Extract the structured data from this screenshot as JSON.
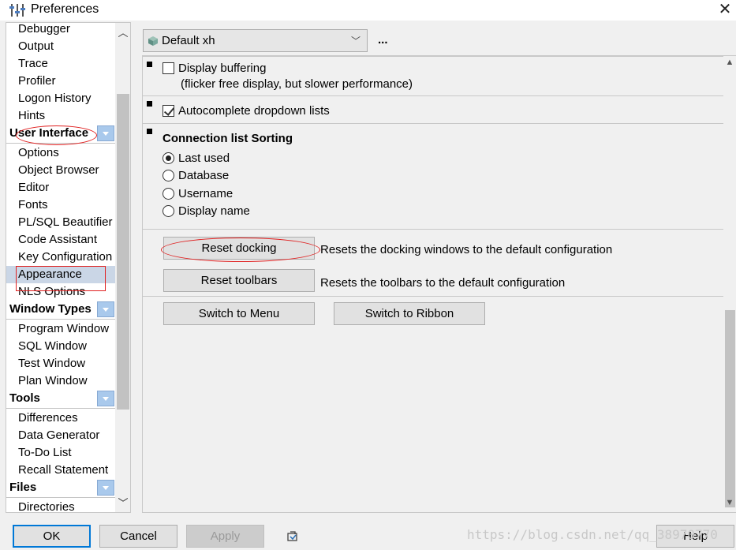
{
  "window": {
    "title": "Preferences"
  },
  "sidebar": {
    "items": [
      {
        "label": "Debugger",
        "type": "item"
      },
      {
        "label": "Output",
        "type": "item"
      },
      {
        "label": "Trace",
        "type": "item"
      },
      {
        "label": "Profiler",
        "type": "item"
      },
      {
        "label": "Logon History",
        "type": "item"
      },
      {
        "label": "Hints",
        "type": "item"
      },
      {
        "label": "User Interface",
        "type": "header"
      },
      {
        "label": "Options",
        "type": "item"
      },
      {
        "label": "Object Browser",
        "type": "item"
      },
      {
        "label": "Editor",
        "type": "item"
      },
      {
        "label": "Fonts",
        "type": "item"
      },
      {
        "label": "PL/SQL Beautifier",
        "type": "item"
      },
      {
        "label": "Code Assistant",
        "type": "item"
      },
      {
        "label": "Key Configuration",
        "type": "item"
      },
      {
        "label": "Appearance",
        "type": "item",
        "selected": true
      },
      {
        "label": "NLS Options",
        "type": "item"
      },
      {
        "label": "Window Types",
        "type": "header"
      },
      {
        "label": "Program Window",
        "type": "item"
      },
      {
        "label": "SQL Window",
        "type": "item"
      },
      {
        "label": "Test Window",
        "type": "item"
      },
      {
        "label": "Plan Window",
        "type": "item"
      },
      {
        "label": "Tools",
        "type": "header"
      },
      {
        "label": "Differences",
        "type": "item"
      },
      {
        "label": "Data Generator",
        "type": "item"
      },
      {
        "label": "To-Do List",
        "type": "item"
      },
      {
        "label": "Recall Statement",
        "type": "item"
      },
      {
        "label": "Files",
        "type": "header"
      },
      {
        "label": "Directories",
        "type": "item"
      }
    ]
  },
  "profile": {
    "selected": "Default xh",
    "more_label": "..."
  },
  "options": {
    "display_buffering": {
      "label": "Display buffering",
      "note": "(flicker free display, but slower performance)",
      "checked": false
    },
    "autocomplete": {
      "label": "Autocomplete dropdown lists",
      "checked": true
    },
    "sorting": {
      "title": "Connection list Sorting",
      "choices": [
        "Last used",
        "Database",
        "Username",
        "Display name"
      ],
      "selected": "Last used"
    }
  },
  "actions": {
    "reset_docking": {
      "label": "Reset docking",
      "desc": "Resets the docking windows to the default configuration"
    },
    "reset_toolbars": {
      "label": "Reset toolbars",
      "desc": "Resets the toolbars to the default configuration"
    },
    "switch_menu": {
      "label": "Switch to Menu"
    },
    "switch_ribbon": {
      "label": "Switch to Ribbon"
    }
  },
  "footer": {
    "ok": "OK",
    "cancel": "Cancel",
    "apply": "Apply",
    "help": "Help",
    "watermark": "https://blog.csdn.net/qq_38970770"
  },
  "colors": {
    "selection": "#cad6e6",
    "header_dropdown": "#a9c9ec",
    "annotation_red": "#e02020",
    "primary_border": "#0078d7"
  }
}
